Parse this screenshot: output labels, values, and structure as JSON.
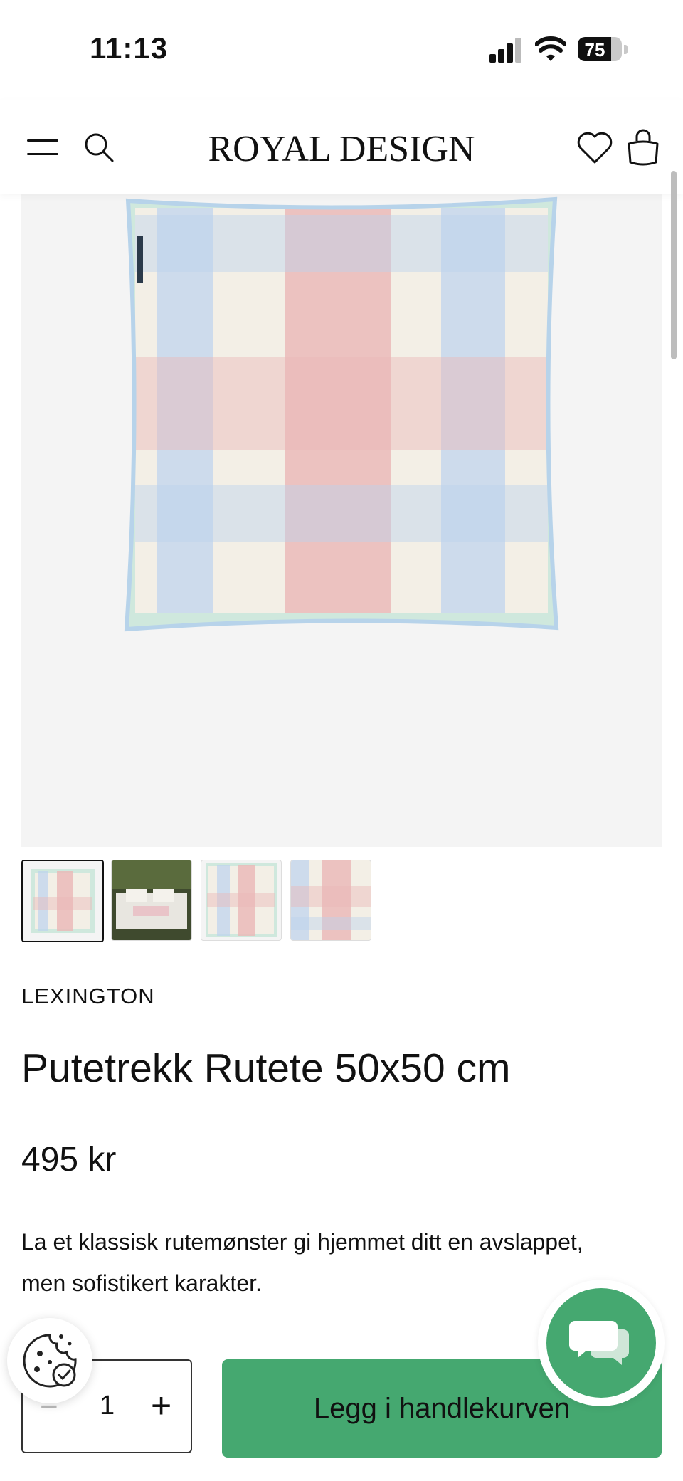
{
  "status_bar": {
    "time": "11:13",
    "battery": "75",
    "battery_level": 0.75
  },
  "header": {
    "logo": "ROYAL DESIGN"
  },
  "product": {
    "brand": "LEXINGTON",
    "title": "Putetrekk Rutete 50x50 cm",
    "price": "495 kr",
    "description": "La et klassisk rutemønster gi hjemmet ditt en avslappet, men sofistikert karakter."
  },
  "purchase": {
    "quantity": "1",
    "minus": "−",
    "plus": "+",
    "add_to_cart": "Legg i handlekurven"
  },
  "colors": {
    "accent": "#45a870",
    "gallery_bg": "#f4f4f4"
  },
  "icons": [
    "menu-icon",
    "search-icon",
    "heart-icon",
    "bag-icon",
    "chat-icon",
    "cookie-icon"
  ]
}
